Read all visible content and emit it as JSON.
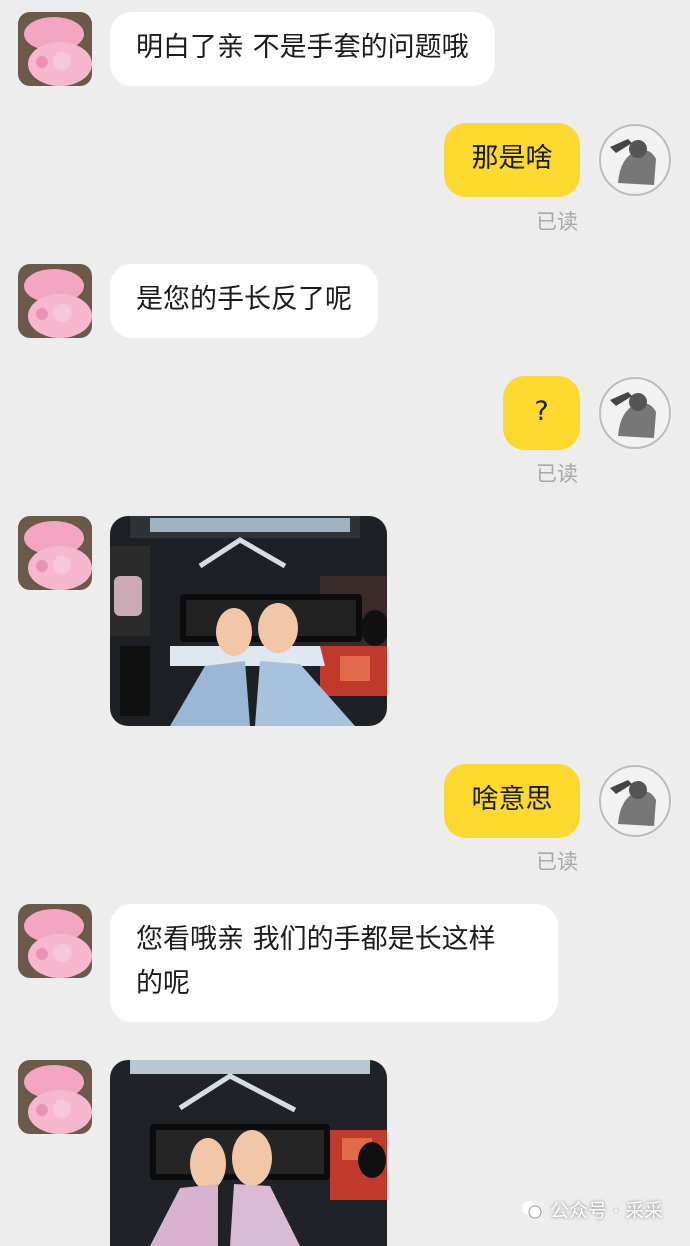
{
  "messages": [
    {
      "side": "left",
      "text": "明白了亲 不是手套的问题哦"
    },
    {
      "side": "right",
      "text": "那是啥",
      "status": "已读"
    },
    {
      "side": "left",
      "text": "是您的手长反了呢"
    },
    {
      "side": "right",
      "text": "?",
      "status": "已读"
    },
    {
      "side": "left",
      "image": "photo-hands-on-keyboard"
    },
    {
      "side": "right",
      "text": "啥意思",
      "status": "已读"
    },
    {
      "side": "left",
      "line1": "您看哦亲 我们的手都是长这样",
      "line2": "的呢"
    },
    {
      "side": "left",
      "image": "photo-hands-on-keyboard"
    }
  ],
  "watermark": {
    "text": "公众号 · 采采",
    "icon": "wechat-channel-icon"
  },
  "colors": {
    "background": "#ededed",
    "incoming": "#ffffff",
    "outgoing": "#fbd92f",
    "read": "#a8a8a8"
  }
}
